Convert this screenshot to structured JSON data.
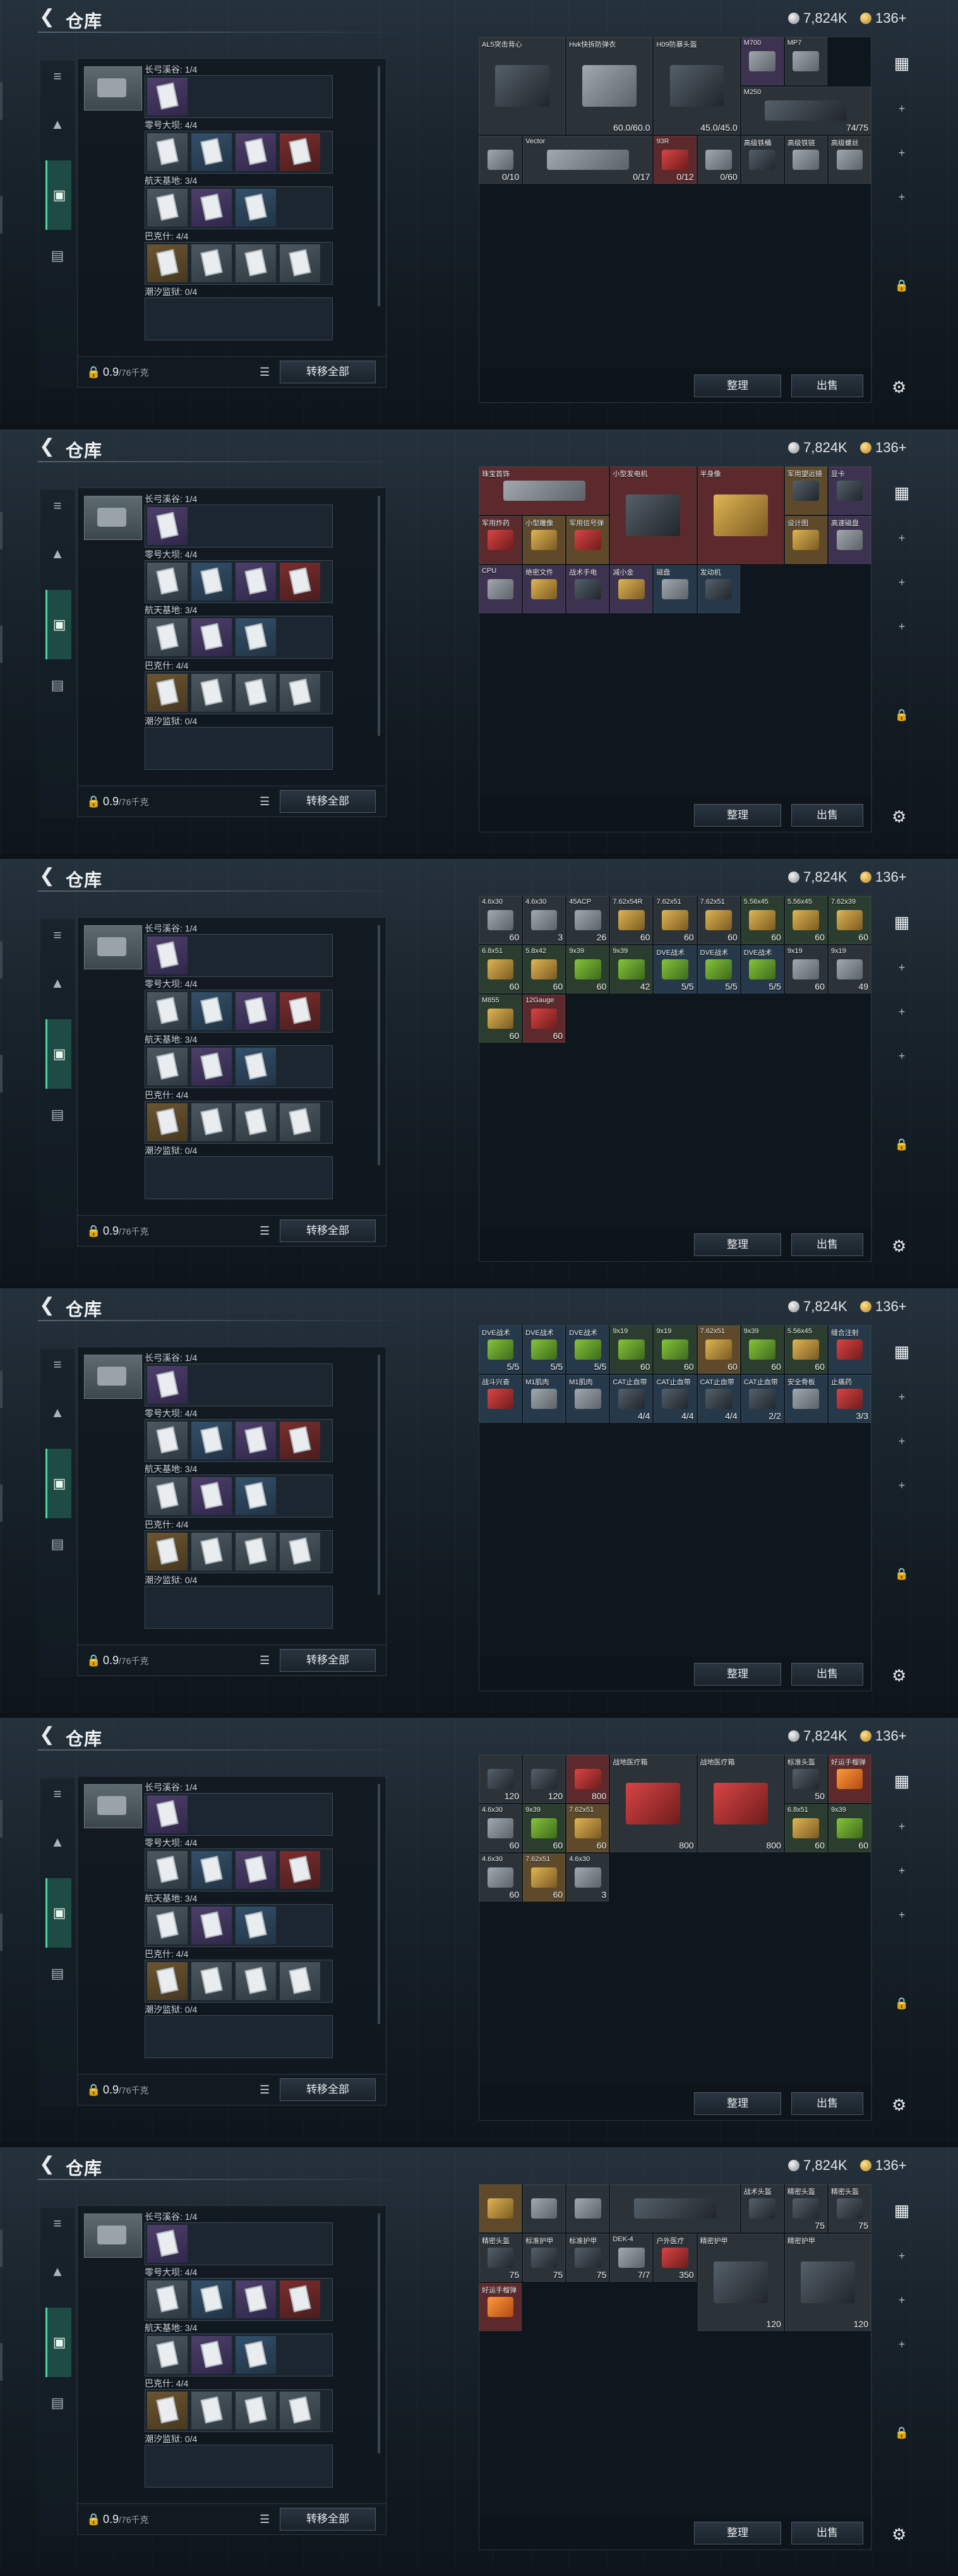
{
  "app": {
    "title": "仓库",
    "silver": "7,824K",
    "gold": "136+"
  },
  "left": {
    "sections": [
      {
        "label": "长弓溪谷: 1/4",
        "slots": [
          "purple"
        ]
      },
      {
        "label": "零号大坝: 4/4",
        "slots": [
          "gray",
          "blue",
          "purple",
          "red"
        ]
      },
      {
        "label": "航天基地: 3/4",
        "slots": [
          "gray",
          "purple",
          "blue"
        ]
      },
      {
        "label": "巴克什: 4/4",
        "slots": [
          "gold",
          "gray",
          "gray",
          "gray"
        ]
      },
      {
        "label": "潮汐监狱: 0/4",
        "slots": []
      }
    ],
    "capacity": "0.9",
    "capacity_unit": "/76千克",
    "transfer_label": "转移全部"
  },
  "right": {
    "sort_label": "整理",
    "sell_label": "出售"
  },
  "frames": [
    {
      "cells": [
        {
          "n": "AL5突击背心",
          "c": "",
          "bg": "bg-gray",
          "o": "o-dark",
          "s": "big"
        },
        {
          "n": "Hvk快拆防弹衣",
          "c": "60.0/60.0",
          "bg": "bg-gray",
          "o": "o-metal",
          "s": "big"
        },
        {
          "n": "H09防暴头盔",
          "c": "45.0/45.0",
          "bg": "bg-gray",
          "o": "o-dark",
          "s": "big"
        },
        {
          "n": "M700",
          "c": "",
          "bg": "bg-purple",
          "o": "o-metal",
          "s": ""
        },
        {
          "n": "MP7",
          "c": "",
          "bg": "bg-gray",
          "o": "o-metal",
          "s": ""
        },
        {
          "n": "M250",
          "c": "74/75",
          "bg": "bg-gray",
          "o": "o-dark",
          "s": "wide"
        },
        {
          "n": "",
          "c": "0/10",
          "bg": "bg-gray",
          "o": "o-metal",
          "s": ""
        },
        {
          "n": "Vector",
          "c": "0/17",
          "bg": "bg-gray",
          "o": "o-metal",
          "s": "wide"
        },
        {
          "n": "93R",
          "c": "0/12",
          "bg": "bg-red",
          "o": "o-red",
          "s": ""
        },
        {
          "n": "",
          "c": "0/60",
          "bg": "bg-gray",
          "o": "o-metal",
          "s": ""
        },
        {
          "n": "高级铁桶",
          "c": "",
          "bg": "bg-gray",
          "o": "o-dark",
          "s": ""
        },
        {
          "n": "高级铁链",
          "c": "",
          "bg": "bg-gray",
          "o": "o-metal",
          "s": ""
        },
        {
          "n": "高级螺丝",
          "c": "",
          "bg": "bg-gray",
          "o": "o-metal",
          "s": ""
        }
      ]
    },
    {
      "cells": [
        {
          "n": "珠宝首饰",
          "c": "",
          "bg": "bg-red",
          "o": "o-metal",
          "s": "wide"
        },
        {
          "n": "小型发电机",
          "c": "",
          "bg": "bg-red",
          "o": "o-dark",
          "s": "big"
        },
        {
          "n": "半身像",
          "c": "",
          "bg": "bg-red",
          "o": "o-gold",
          "s": "big"
        },
        {
          "n": "军用望远镜",
          "c": "",
          "bg": "bg-gold",
          "o": "o-dark",
          "s": ""
        },
        {
          "n": "显卡",
          "c": "",
          "bg": "bg-purple",
          "o": "o-dark",
          "s": ""
        },
        {
          "n": "军用炸药",
          "c": "",
          "bg": "bg-red",
          "o": "o-red",
          "s": ""
        },
        {
          "n": "小型雕像",
          "c": "",
          "bg": "bg-gold",
          "o": "o-gold",
          "s": ""
        },
        {
          "n": "军用信号弹",
          "c": "",
          "bg": "bg-gold",
          "o": "o-red",
          "s": ""
        },
        {
          "n": "设计图",
          "c": "",
          "bg": "bg-gold",
          "o": "o-gold",
          "s": ""
        },
        {
          "n": "高速磁盘",
          "c": "",
          "bg": "bg-purple",
          "o": "o-metal",
          "s": ""
        },
        {
          "n": "CPU",
          "c": "",
          "bg": "bg-purple",
          "o": "o-metal",
          "s": ""
        },
        {
          "n": "绝密文件",
          "c": "",
          "bg": "bg-purple",
          "o": "o-gold",
          "s": ""
        },
        {
          "n": "战术手电",
          "c": "",
          "bg": "bg-purple",
          "o": "o-dark",
          "s": ""
        },
        {
          "n": "减小金",
          "c": "",
          "bg": "bg-purple",
          "o": "o-gold",
          "s": ""
        },
        {
          "n": "磁盘",
          "c": "",
          "bg": "bg-blue",
          "o": "o-metal",
          "s": ""
        },
        {
          "n": "发动机",
          "c": "",
          "bg": "bg-blue",
          "o": "o-dark",
          "s": ""
        }
      ]
    },
    {
      "cells": [
        {
          "n": "4.6x30",
          "c": "60",
          "bg": "bg-gray",
          "o": "o-metal",
          "s": ""
        },
        {
          "n": "4.6x30",
          "c": "3",
          "bg": "bg-gray",
          "o": "o-metal",
          "s": ""
        },
        {
          "n": "45ACP",
          "c": "26",
          "bg": "bg-gray",
          "o": "o-metal",
          "s": ""
        },
        {
          "n": "7.62x54R",
          "c": "60",
          "bg": "bg-gray",
          "o": "o-gold",
          "s": ""
        },
        {
          "n": "7.62x51",
          "c": "60",
          "bg": "bg-gray",
          "o": "o-gold",
          "s": ""
        },
        {
          "n": "7.62x51",
          "c": "60",
          "bg": "bg-gray",
          "o": "o-gold",
          "s": ""
        },
        {
          "n": "5.56x45",
          "c": "60",
          "bg": "bg-green",
          "o": "o-gold",
          "s": ""
        },
        {
          "n": "5.56x45",
          "c": "60",
          "bg": "bg-green",
          "o": "o-gold",
          "s": ""
        },
        {
          "n": "7.62x39",
          "c": "60",
          "bg": "bg-green",
          "o": "o-gold",
          "s": ""
        },
        {
          "n": "6.8x51",
          "c": "60",
          "bg": "bg-green",
          "o": "o-gold",
          "s": ""
        },
        {
          "n": "5.8x42",
          "c": "60",
          "bg": "bg-green",
          "o": "o-gold",
          "s": ""
        },
        {
          "n": "9x39",
          "c": "60",
          "bg": "bg-green",
          "o": "o-green",
          "s": ""
        },
        {
          "n": "9x39",
          "c": "42",
          "bg": "bg-green",
          "o": "o-green",
          "s": ""
        },
        {
          "n": "DVE战术",
          "c": "5/5",
          "bg": "bg-blue",
          "o": "o-green",
          "s": ""
        },
        {
          "n": "DVE战术",
          "c": "5/5",
          "bg": "bg-blue",
          "o": "o-green",
          "s": ""
        },
        {
          "n": "DVE战术",
          "c": "5/5",
          "bg": "bg-blue",
          "o": "o-green",
          "s": ""
        },
        {
          "n": "9x19",
          "c": "60",
          "bg": "bg-gray",
          "o": "o-metal",
          "s": ""
        },
        {
          "n": "9x19",
          "c": "49",
          "bg": "bg-gray",
          "o": "o-metal",
          "s": ""
        },
        {
          "n": "M855",
          "c": "60",
          "bg": "bg-green",
          "o": "o-gold",
          "s": ""
        },
        {
          "n": "12Gauge",
          "c": "60",
          "bg": "bg-red",
          "o": "o-red",
          "s": ""
        }
      ]
    },
    {
      "cells": [
        {
          "n": "DVE战术",
          "c": "5/5",
          "bg": "bg-blue",
          "o": "o-green",
          "s": ""
        },
        {
          "n": "DVE战术",
          "c": "5/5",
          "bg": "bg-blue",
          "o": "o-green",
          "s": ""
        },
        {
          "n": "DVE战术",
          "c": "5/5",
          "bg": "bg-blue",
          "o": "o-green",
          "s": ""
        },
        {
          "n": "9x19",
          "c": "60",
          "bg": "bg-green",
          "o": "o-green",
          "s": ""
        },
        {
          "n": "9x19",
          "c": "60",
          "bg": "bg-green",
          "o": "o-green",
          "s": ""
        },
        {
          "n": "7.62x51",
          "c": "60",
          "bg": "bg-gold",
          "o": "o-gold",
          "s": ""
        },
        {
          "n": "9x39",
          "c": "60",
          "bg": "bg-green",
          "o": "o-green",
          "s": ""
        },
        {
          "n": "5.56x45",
          "c": "60",
          "bg": "bg-green",
          "o": "o-gold",
          "s": ""
        },
        {
          "n": "缝合注射",
          "c": "",
          "bg": "bg-blue",
          "o": "o-red",
          "s": ""
        },
        {
          "n": "战斗兴奋",
          "c": "",
          "bg": "bg-blue",
          "o": "o-red",
          "s": ""
        },
        {
          "n": "M1肌肉",
          "c": "",
          "bg": "bg-blue",
          "o": "o-metal",
          "s": ""
        },
        {
          "n": "M1肌肉",
          "c": "",
          "bg": "bg-blue",
          "o": "o-metal",
          "s": ""
        },
        {
          "n": "CAT止血带",
          "c": "4/4",
          "bg": "bg-blue",
          "o": "o-dark",
          "s": ""
        },
        {
          "n": "CAT止血带",
          "c": "4/4",
          "bg": "bg-blue",
          "o": "o-dark",
          "s": ""
        },
        {
          "n": "CAT止血带",
          "c": "4/4",
          "bg": "bg-blue",
          "o": "o-dark",
          "s": ""
        },
        {
          "n": "CAT止血带",
          "c": "2/2",
          "bg": "bg-blue",
          "o": "o-dark",
          "s": ""
        },
        {
          "n": "安全骨板",
          "c": "",
          "bg": "bg-blue",
          "o": "o-metal",
          "s": ""
        },
        {
          "n": "止痛药",
          "c": "3/3",
          "bg": "bg-blue",
          "o": "o-red",
          "s": ""
        }
      ]
    },
    {
      "cells": [
        {
          "n": "",
          "c": "120",
          "bg": "bg-gray",
          "o": "o-dark",
          "s": ""
        },
        {
          "n": "",
          "c": "120",
          "bg": "bg-gray",
          "o": "o-dark",
          "s": ""
        },
        {
          "n": "",
          "c": "800",
          "bg": "bg-red",
          "o": "o-red",
          "s": ""
        },
        {
          "n": "战地医疗箱",
          "c": "800",
          "bg": "bg-gray",
          "o": "o-red",
          "s": "big"
        },
        {
          "n": "战地医疗箱",
          "c": "800",
          "bg": "bg-gray",
          "o": "o-red",
          "s": "big"
        },
        {
          "n": "标准头盔",
          "c": "50",
          "bg": "bg-gray",
          "o": "o-dark",
          "s": ""
        },
        {
          "n": "好运手榴弹",
          "c": "",
          "bg": "bg-red",
          "o": "o-orange",
          "s": ""
        },
        {
          "n": "4.6x30",
          "c": "60",
          "bg": "bg-gray",
          "o": "o-metal",
          "s": ""
        },
        {
          "n": "9x39",
          "c": "60",
          "bg": "bg-green",
          "o": "o-green",
          "s": ""
        },
        {
          "n": "7.62x51",
          "c": "60",
          "bg": "bg-gold",
          "o": "o-gold",
          "s": ""
        },
        {
          "n": "6.8x51",
          "c": "60",
          "bg": "bg-green",
          "o": "o-gold",
          "s": ""
        },
        {
          "n": "9x39",
          "c": "60",
          "bg": "bg-green",
          "o": "o-green",
          "s": ""
        },
        {
          "n": "4.6x30",
          "c": "60",
          "bg": "bg-gray",
          "o": "o-metal",
          "s": ""
        },
        {
          "n": "7.62x51",
          "c": "60",
          "bg": "bg-gold",
          "o": "o-gold",
          "s": ""
        },
        {
          "n": "4.6x30",
          "c": "3",
          "bg": "bg-gray",
          "o": "o-metal",
          "s": ""
        }
      ]
    },
    {
      "cells": [
        {
          "n": "",
          "c": "",
          "bg": "bg-gold",
          "o": "o-gold",
          "s": ""
        },
        {
          "n": "",
          "c": "",
          "bg": "bg-gray",
          "o": "o-metal",
          "s": ""
        },
        {
          "n": "",
          "c": "",
          "bg": "bg-gray",
          "o": "o-metal",
          "s": ""
        },
        {
          "n": "",
          "c": "",
          "bg": "bg-gray",
          "o": "o-dark",
          "s": "wide"
        },
        {
          "n": "战术头盔",
          "c": "",
          "bg": "bg-gray",
          "o": "o-dark",
          "s": ""
        },
        {
          "n": "精密头盔",
          "c": "75",
          "bg": "bg-gray",
          "o": "o-dark",
          "s": ""
        },
        {
          "n": "精密头盔",
          "c": "75",
          "bg": "bg-gray",
          "o": "o-dark",
          "s": ""
        },
        {
          "n": "精密头盔",
          "c": "75",
          "bg": "bg-gray",
          "o": "o-dark",
          "s": ""
        },
        {
          "n": "标准护甲",
          "c": "75",
          "bg": "bg-gray",
          "o": "o-dark",
          "s": ""
        },
        {
          "n": "标准护甲",
          "c": "75",
          "bg": "bg-gray",
          "o": "o-dark",
          "s": ""
        },
        {
          "n": "DEK-4",
          "c": "7/7",
          "bg": "bg-gray",
          "o": "o-metal",
          "s": ""
        },
        {
          "n": "户外医疗",
          "c": "350",
          "bg": "bg-gray",
          "o": "o-red",
          "s": ""
        },
        {
          "n": "精密护甲",
          "c": "120",
          "bg": "bg-gray",
          "o": "o-dark",
          "s": "big"
        },
        {
          "n": "精密护甲",
          "c": "120",
          "bg": "bg-gray",
          "o": "o-dark",
          "s": "big"
        },
        {
          "n": "好运手榴弹",
          "c": "",
          "bg": "bg-red",
          "o": "o-orange",
          "s": ""
        }
      ]
    }
  ]
}
